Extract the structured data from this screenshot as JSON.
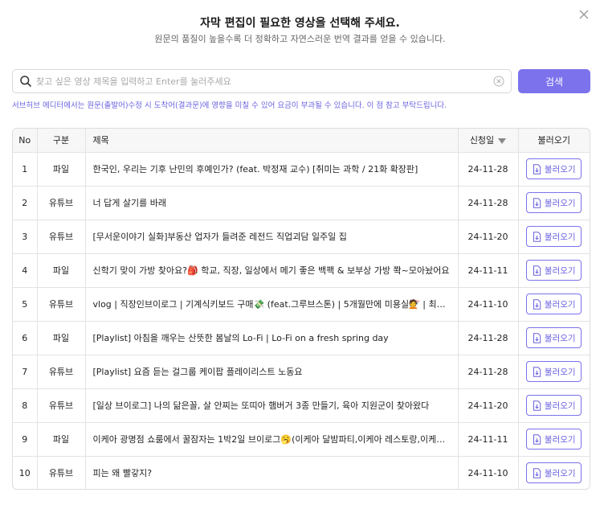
{
  "modal": {
    "title": "자막 편집이 필요한 영상을 선택해 주세요.",
    "subtitle": "원문의 품질이 높을수록 더 정확하고 자연스러운 번역 결과를 얻을 수 있습니다."
  },
  "search": {
    "placeholder": "찾고 싶은 영상 제목을 입력하고 Enter를 눌러주세요",
    "value": "",
    "button_label": "검색"
  },
  "notice": "서브허브 에디터에서는 원문(출발어)수정 시 도착어(결과문)에 영향을 미칠 수 있어 요금이 부과될 수 있습니다. 이 점 참고 부탁드립니다.",
  "table": {
    "headers": {
      "no": "No",
      "type": "구분",
      "title": "제목",
      "date": "신청일",
      "load": "불러오기"
    },
    "rows": [
      {
        "no": "1",
        "type": "파일",
        "title": "한국인, 우리는 기후 난민의 후예인가? (feat. 박정재 교수) [취미는 과학 / 21화 확장판]",
        "date": "24-11-28",
        "load": "불러오기"
      },
      {
        "no": "2",
        "type": "유튜브",
        "title": "너 답게 살기를 바래",
        "date": "24-11-28",
        "load": "불러오기"
      },
      {
        "no": "3",
        "type": "유튜브",
        "title": "[무서운이야기 실화]부동산 업자가 들려준 레전드 직업괴담 일주일 집",
        "date": "24-11-20",
        "load": "불러오기"
      },
      {
        "no": "4",
        "type": "파일",
        "title": "신학기 맞이 가방 찾아요?🎒 학교, 직장, 일상에서 메기 좋은 백팩 & 보부상 가방 쫙~모아놨어요",
        "date": "24-11-11",
        "load": "불러오기"
      },
      {
        "no": "5",
        "type": "유튜브",
        "title": "vlog | 직장인브이로그 | 기계식키보드 구매💸 (feat.그루브스톤) | 5개월만에 미용실💇 | 최애 수제버거",
        "date": "24-11-10",
        "load": "불러오기"
      },
      {
        "no": "6",
        "type": "파일",
        "title": "[Playlist] 아침을 깨우는 산뜻한 봄날의 Lo-Fi | Lo-Fi on a fresh spring day",
        "date": "24-11-28",
        "load": "불러오기"
      },
      {
        "no": "7",
        "type": "유튜브",
        "title": "[Playlist] 요즘 듣는 걸그룹 케이팝 플레이리스트 노동요",
        "date": "24-11-28",
        "load": "불러오기"
      },
      {
        "no": "8",
        "type": "유튜브",
        "title": "[일상 브이로그] 나의 닮은꼴, 살 안찌는 또띠아 햄버거 3종 만들기, 육아 지원군이 찾아왔다",
        "date": "24-11-20",
        "load": "불러오기"
      },
      {
        "no": "9",
        "type": "파일",
        "title": "이케아 광명점 쇼룸에서 꿀잠자는 1박2일 브이로그🥱(이케아 달밤파티,이케아 레스토랑,이케아 투어)",
        "date": "24-11-11",
        "load": "불러오기"
      },
      {
        "no": "10",
        "type": "유튜브",
        "title": "피는 왜 빨갛지?",
        "date": "24-11-10",
        "load": "불러오기"
      }
    ]
  },
  "icons": {
    "close": "close-icon",
    "search": "search-icon",
    "clear": "clear-icon",
    "sort": "sort-down-icon",
    "load": "file-download-icon"
  },
  "colors": {
    "accent": "#7b72ec",
    "notice_text": "#6b62e0",
    "header_bg": "#f7f7f8"
  }
}
